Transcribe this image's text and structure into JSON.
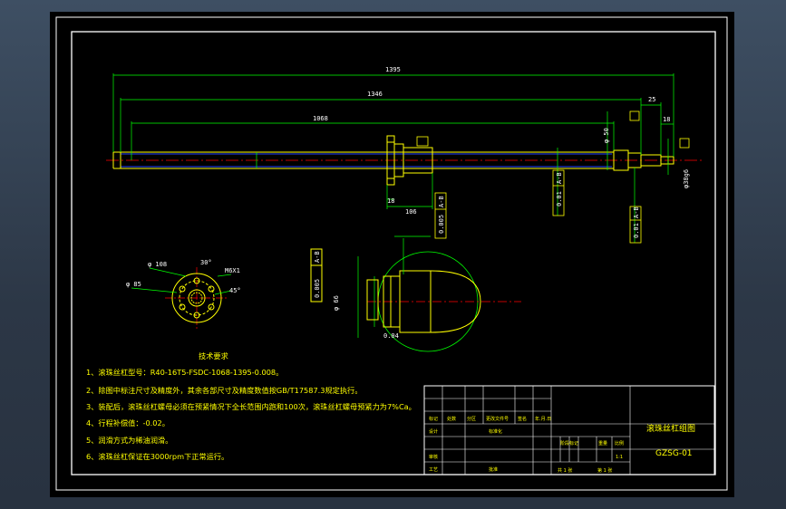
{
  "dimensions": {
    "overall_length": "1395",
    "length_2": "1346",
    "length_3": "1068",
    "nut_width": "106",
    "nut_flange": "18",
    "end_step": "25",
    "end_step_2": "18",
    "dia_50": "φ 50",
    "dia_right": "φ38g6",
    "tol_001_a": "0.01",
    "tol_001_b": "0.01",
    "letter_a": "A-B",
    "dia_108": "φ 108",
    "dia_85": "φ 85",
    "thread_m6": "M6X1",
    "angle_30": "30°",
    "angle_45": "45°",
    "detail_tol": "0.005",
    "dia_detail": "φ 66",
    "tol_004": "0.04"
  },
  "tech_requirements": {
    "title": "技术要求",
    "items": [
      "1、滚珠丝杠型号：R40-16T5-FSDC-1068-1395-0.008。",
      "2、除图中标注尺寸及精度外，其余各部尺寸及精度数值按GB/T17587.3规定执行。",
      "3、装配后，滚珠丝杠螺母必须在预紧情况下全长范围内跑和100次，滚珠丝杠螺母预紧力为7%Ca。",
      "4、行程补偿值：-0.02。",
      "5、润滑方式为稀油润滑。",
      "6、滚珠丝杠保证在3000rpm下正常运行。"
    ]
  },
  "title_block": {
    "drawing_title": "滚珠丝杠组图",
    "drawing_no": "GZSG-01",
    "scale": "1:1",
    "row_labels": [
      "标记",
      "处数",
      "分区",
      "更改文件号",
      "签名",
      "年.月.日"
    ],
    "design_label": "设计",
    "check_label": "审核",
    "process_label": "工艺",
    "standard_label": "标准化",
    "approve_label": "批准",
    "stage_label": "阶段标记",
    "weight_label": "重量",
    "scale_label": "比例",
    "sheets": "共 1 张",
    "sheet_no": "第 1 张"
  },
  "colors": {
    "background": "#000000",
    "frame": "#ffffff",
    "dimension": "#00ff00",
    "centerline": "#ff0000",
    "outline": "#ffff00",
    "hidden": "#0000ff",
    "text": "#ffff00"
  }
}
